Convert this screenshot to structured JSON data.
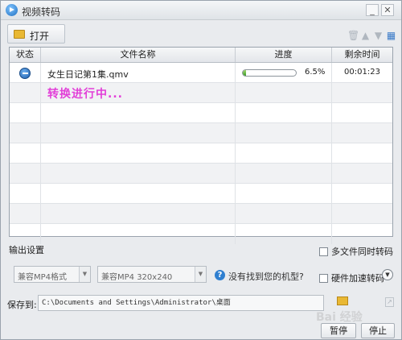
{
  "window": {
    "title": "视频转码",
    "min_label": "_",
    "close_label": "✕"
  },
  "toolbar": {
    "open_label": "打开",
    "icons": [
      "trash-icon",
      "move-up-icon",
      "move-down-icon",
      "grid-view-icon"
    ]
  },
  "table": {
    "columns": [
      "状态",
      "文件名称",
      "进度",
      "剩余时间"
    ],
    "rows": [
      {
        "status_icon": "converting-arrow-icon",
        "filename": "女生日记第1集.qmv",
        "progress": 0.065,
        "progress_text": "6.5%",
        "time_left": "00:01:23"
      }
    ],
    "status_message": "转换进行中..."
  },
  "output": {
    "label": "输出设置",
    "multi_file_label": "多文件同时转码",
    "format_value": "兼容MP4格式",
    "resolution_value": "兼容MP4 320x240",
    "help_text": "没有找到您的机型?",
    "hw_accel_label": "硬件加速转码"
  },
  "save": {
    "label": "保存到:",
    "path": "C:\\Documents and Settings\\Administrator\\桌面"
  },
  "actions": {
    "pause_label": "暂停",
    "stop_label": "停止"
  },
  "watermark": "Bai 经验",
  "colors": {
    "status_message": "#e23fd8",
    "progress_fill": "#3b9a2b",
    "accent": "#2f7fd0"
  }
}
